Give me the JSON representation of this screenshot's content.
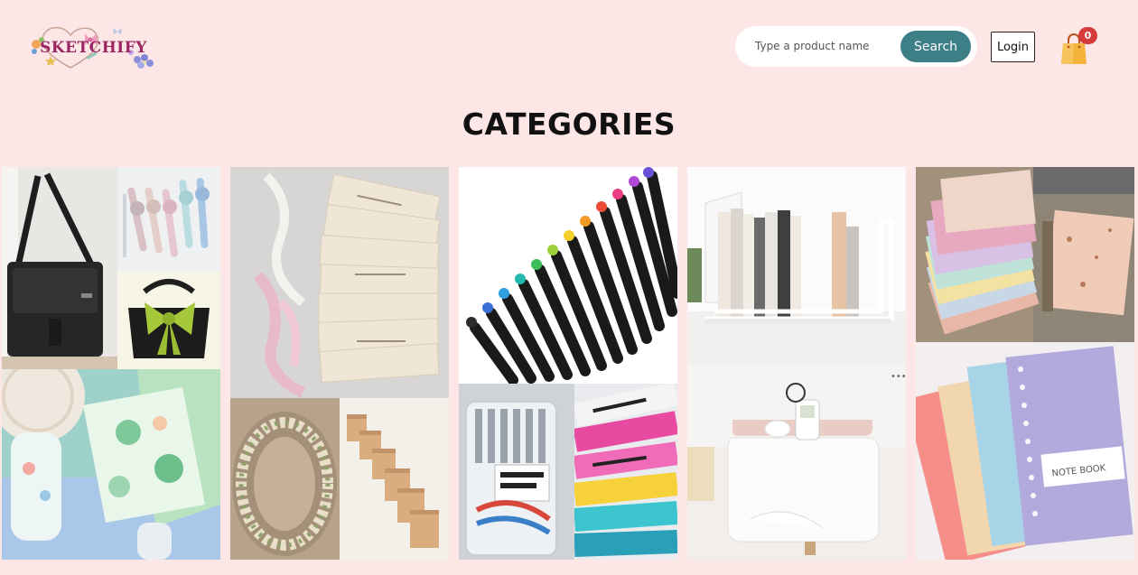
{
  "brand": {
    "name": "SKETCHIFY",
    "colors": {
      "page_bg": "#fde7e6",
      "accent": "#3d7f86",
      "brand": "#9c2563",
      "badge": "#d63a3a",
      "bag": "#f3b33d"
    }
  },
  "header": {
    "search": {
      "placeholder": "Type a product name",
      "button_label": "Search"
    },
    "login_label": "Login",
    "cart": {
      "icon": "shopping-bag-icon",
      "count": "0"
    }
  },
  "main": {
    "title": "CATEGORIES",
    "categories": [
      {
        "name": "bags-watches",
        "photos": [
          "black-messenger-bag",
          "pastel-watches",
          "green-bow-bag",
          "mug-and-pouch"
        ]
      },
      {
        "name": "tags-ribbons",
        "photos": [
          "paper-tags-with-ribbons",
          "bead-wreath",
          "kraft-gift-bags"
        ]
      },
      {
        "name": "pens-markers",
        "photos": [
          "brush-pens",
          "marker-box",
          "colorshot-packs"
        ]
      },
      {
        "name": "desk-organizers",
        "photos": [
          "bookshelf-organizer",
          "desk-tissue-organizer"
        ]
      },
      {
        "name": "paper-notebooks",
        "photos": [
          "handmade-paper",
          "notebook"
        ]
      }
    ]
  }
}
